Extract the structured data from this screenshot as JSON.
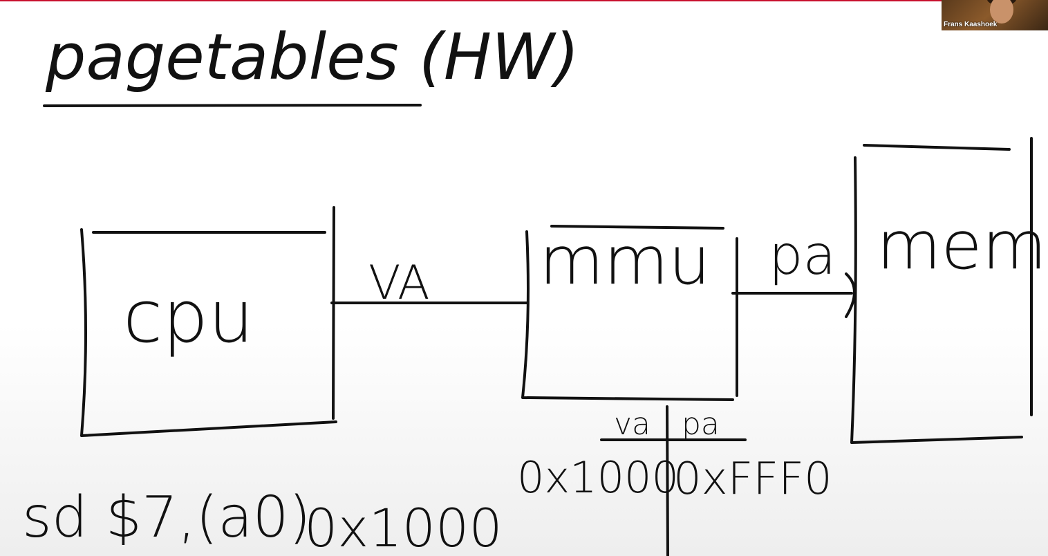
{
  "slide": {
    "title": "pagetables (HW)",
    "cpu_label": "cpu",
    "va_label": "VA",
    "mmu_label": "mmu",
    "pa_label": "pa",
    "mem_label": "mem",
    "table_header_va": "va",
    "table_header_pa": "pa",
    "table_va_value": "0x1000",
    "table_pa_value": "0xFFF0",
    "instruction": "sd $7,(a0)",
    "instruction_addr": "0x1000"
  },
  "video": {
    "speaker_name": "Frans Kaashoek"
  },
  "colors": {
    "ink": "#111111",
    "top_bar": "#c8102e"
  }
}
